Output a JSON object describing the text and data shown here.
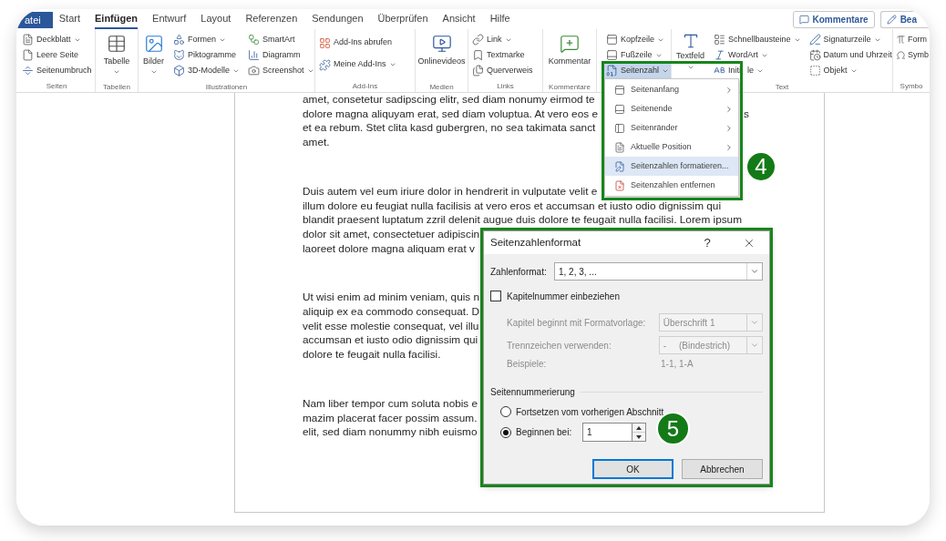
{
  "file_tab": {
    "label": "atei"
  },
  "tabs": [
    {
      "label": "Start",
      "selected": false
    },
    {
      "label": "Einfügen",
      "selected": true
    },
    {
      "label": "Entwurf",
      "selected": false
    },
    {
      "label": "Layout",
      "selected": false
    },
    {
      "label": "Referenzen",
      "selected": false
    },
    {
      "label": "Sendungen",
      "selected": false
    },
    {
      "label": "Überprüfen",
      "selected": false
    },
    {
      "label": "Ansicht",
      "selected": false
    },
    {
      "label": "Hilfe",
      "selected": false
    }
  ],
  "header_buttons": [
    {
      "kind": "comments",
      "label": "Kommentare"
    },
    {
      "kind": "edit",
      "label": "Bea"
    }
  ],
  "ribbon": {
    "groups": [
      {
        "label": "Seiten",
        "columns": [
          [
            {
              "kind": "small",
              "label": "Deckblatt",
              "dropdown": true
            },
            {
              "kind": "small",
              "label": "Leere Seite",
              "dropdown": false
            },
            {
              "kind": "small",
              "label": "Seitenumbruch",
              "dropdown": false
            }
          ]
        ]
      },
      {
        "label": "Tabellen",
        "columns": [
          [
            {
              "kind": "large",
              "label": "Tabelle",
              "dropdown": true
            }
          ]
        ]
      },
      {
        "label": "Illustrationen",
        "columns": [
          [
            {
              "kind": "large",
              "label": "Bilder",
              "dropdown": true
            }
          ],
          [
            {
              "kind": "small",
              "label": "Formen",
              "dropdown": true
            },
            {
              "kind": "small",
              "label": "Piktogramme",
              "dropdown": false
            },
            {
              "kind": "small",
              "label": "3D-Modelle",
              "dropdown": true
            }
          ],
          [
            {
              "kind": "small",
              "label": "SmartArt",
              "dropdown": false
            },
            {
              "kind": "small",
              "label": "Diagramm",
              "dropdown": false
            },
            {
              "kind": "small",
              "label": "Screenshot",
              "dropdown": true
            }
          ]
        ]
      },
      {
        "label": "Add-Ins",
        "columns": [
          [
            {
              "kind": "small",
              "label": "Add-Ins abrufen",
              "dropdown": false
            },
            {
              "kind": "small",
              "label": "Meine Add-Ins",
              "dropdown": true
            }
          ]
        ]
      },
      {
        "label": "Medien",
        "columns": [
          [
            {
              "kind": "large",
              "label": "Onlinevideos",
              "dropdown": false
            }
          ]
        ]
      },
      {
        "label": "Links",
        "columns": [
          [
            {
              "kind": "small",
              "label": "Link",
              "dropdown": true
            },
            {
              "kind": "small",
              "label": "Textmarke",
              "dropdown": false
            },
            {
              "kind": "small",
              "label": "Querverweis",
              "dropdown": false
            }
          ]
        ]
      },
      {
        "label": "Kommentare",
        "columns": [
          [
            {
              "kind": "large",
              "label": "Kommentar",
              "dropdown": false
            }
          ]
        ]
      },
      {
        "columns": [
          [
            {
              "kind": "small",
              "label": "Kopfzeile",
              "dropdown": true,
              "open": false
            },
            {
              "kind": "small",
              "label": "Fußzeile",
              "dropdown": true,
              "open": false
            },
            {
              "kind": "small",
              "label": "Seitenzahl",
              "dropdown": true,
              "open": true
            }
          ]
        ]
      },
      {
        "label": "Text",
        "columns": [
          [
            {
              "kind": "large",
              "label": "Textfeld",
              "dropdown": true
            }
          ],
          [
            {
              "kind": "small",
              "label": "Schnellbausteine",
              "dropdown": true
            },
            {
              "kind": "small",
              "label": "WordArt",
              "dropdown": true
            },
            {
              "kind": "small",
              "label": "Initi",
              "label_tail": "le",
              "dropdown": true
            }
          ],
          [
            {
              "kind": "small",
              "label": "Signaturzeile",
              "dropdown": true
            },
            {
              "kind": "small",
              "label": "Datum und Uhrzeit",
              "dropdown": false
            },
            {
              "kind": "small",
              "label": "Objekt",
              "dropdown": true
            }
          ]
        ]
      },
      {
        "label": "Symbo",
        "columns": [
          [
            {
              "kind": "small",
              "label": "Form",
              "dropdown": false
            },
            {
              "kind": "small",
              "label": "Symb",
              "dropdown": false
            }
          ]
        ]
      }
    ]
  },
  "document": {
    "paragraphs": [
      {
        "lines": [
          {
            "text": "amet, consetetur sadipscing elitr, sed diam nonumy eirmod te"
          },
          {
            "text": "dolore magna aliquyam erat, sed diam voluptua. At vero eos e",
            "tail": "s"
          },
          {
            "text": "et ea rebum. Stet clita kasd gubergren, no sea takimata sanct"
          },
          {
            "text": "amet."
          }
        ]
      },
      {
        "lines": [
          {
            "text": "Duis autem vel eum iriure dolor in hendrerit in vulputate velit e"
          },
          {
            "text": "illum dolore eu feugiat nulla facilisis at vero eros et accumsan et iusto odio dignissim qui"
          },
          {
            "text": "blandit praesent luptatum zzril delenit augue duis dolore te feugait nulla facilisi. Lorem ipsum"
          },
          {
            "text": "dolor sit amet, consectetuer adipiscin"
          },
          {
            "text": "laoreet dolore magna aliquam erat v"
          }
        ]
      },
      {
        "lines": [
          {
            "text": "Ut wisi enim ad minim veniam, quis n"
          },
          {
            "text": "aliquip ex ea commodo consequat. D"
          },
          {
            "text": "velit esse molestie consequat, vel illu"
          },
          {
            "text": "accumsan et iusto odio dignissim qui"
          },
          {
            "text": "dolore te feugait nulla facilisi."
          }
        ]
      },
      {
        "lines": [
          {
            "text": "Nam liber tempor cum soluta nobis e"
          },
          {
            "text": "mazim placerat facer possim assum."
          },
          {
            "text": "elit, sed diam nonummy nibh euismo"
          }
        ]
      }
    ]
  },
  "page_number_menu": {
    "items": [
      {
        "label": "Seitenanfang",
        "submenu": true,
        "selected": false
      },
      {
        "label": "Seitenende",
        "submenu": true,
        "selected": false
      },
      {
        "label": "Seitenränder",
        "submenu": true,
        "selected": false
      },
      {
        "label": "Aktuelle Position",
        "submenu": true,
        "selected": false
      },
      {
        "label": "Seitenzahlen formatieren...",
        "submenu": false,
        "selected": true
      },
      {
        "label": "Seitenzahlen entfernen",
        "submenu": false,
        "selected": false
      }
    ]
  },
  "dialog": {
    "title": "Seitenzahlenformat",
    "help": "?",
    "number_format": {
      "label": "Zahlenformat:",
      "value": "1, 2, 3, ..."
    },
    "include_chapter": {
      "label": "Kapitelnummer einbeziehen",
      "checked": false
    },
    "chapter_style": {
      "label": "Kapitel beginnt mit Formatvorlage:",
      "value": "Überschrift 1",
      "disabled": true
    },
    "separator": {
      "label": "Trennzeichen verwenden:",
      "value": "-     (Bindestrich)",
      "disabled": true
    },
    "examples": {
      "label": "Beispiele:",
      "value": "1-1, 1-A",
      "disabled": true
    },
    "numbering": {
      "label": "Seitennummerierung",
      "options": [
        {
          "kind": "plain",
          "label": "Fortsetzen vom vorherigen Abschnitt",
          "selected": false
        },
        {
          "kind": "start_at",
          "label": "Beginnen bei:",
          "selected": true,
          "value": "1"
        }
      ]
    },
    "buttons": [
      {
        "label": "OK",
        "default": true
      },
      {
        "label": "Abbrechen",
        "default": false
      }
    ]
  },
  "callouts": [
    {
      "number": "4"
    },
    {
      "number": "5"
    }
  ]
}
